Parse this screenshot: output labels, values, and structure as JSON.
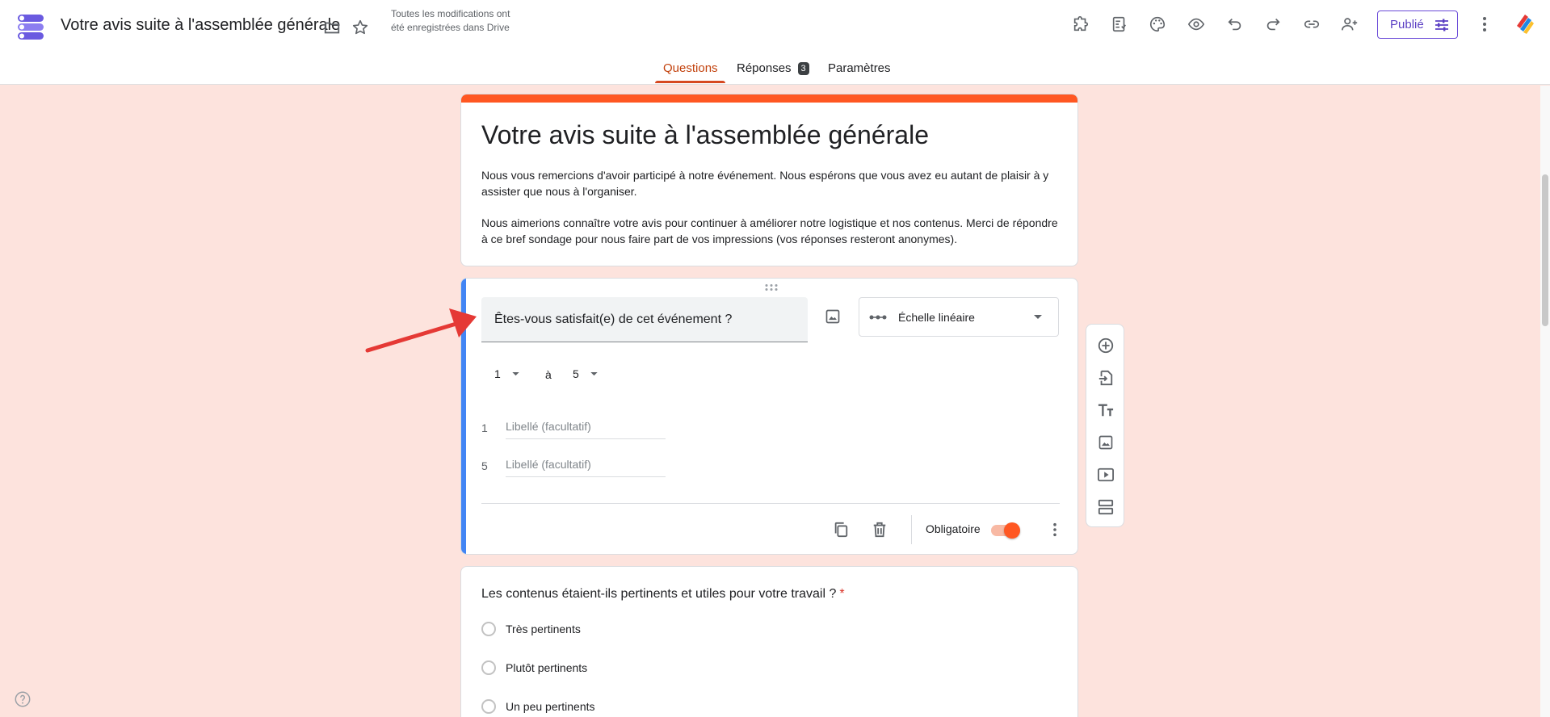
{
  "header": {
    "doc_title": "Votre avis suite à l'assemblée générale",
    "save_status": "Toutes les modifications ont été enregistrées dans Drive",
    "publish_label": "Publié",
    "icons": [
      "folder-icon",
      "star-icon",
      "addon-icon",
      "quiz-icon",
      "palette-icon",
      "preview-icon",
      "undo-icon",
      "redo-icon",
      "link-icon",
      "add-collaborator-icon",
      "more-vert-icon"
    ]
  },
  "tabs": [
    {
      "label": "Questions",
      "active": true
    },
    {
      "label": "Réponses",
      "badge": "3"
    },
    {
      "label": "Paramètres"
    }
  ],
  "form": {
    "title": "Votre avis suite à l'assemblée générale",
    "description": [
      "Nous vous remercions d'avoir participé à notre événement. Nous espérons que vous avez eu autant de plaisir à y assister que nous à l'organiser.",
      "Nous aimerions connaître votre avis pour continuer à améliorer notre logistique et nos contenus. Merci de répondre à ce bref sondage pour nous faire part de vos impressions (vos réponses resteront anonymes)."
    ],
    "accent_color": "#ff5722"
  },
  "question1": {
    "text": "Êtes-vous satisfait(e) de cet événement ?",
    "type_label": "Échelle linéaire",
    "scale_min": "1",
    "scale_word": "à",
    "scale_max": "5",
    "labels": [
      {
        "num": "1",
        "placeholder": "Libellé (facultatif)"
      },
      {
        "num": "5",
        "placeholder": "Libellé (facultatif)"
      }
    ],
    "required_label": "Obligatoire",
    "required_on": true
  },
  "question2": {
    "text": "Les contenus étaient-ils pertinents et utiles pour votre travail ?",
    "required_mark": "*",
    "options": [
      "Très pertinents",
      "Plutôt pertinents",
      "Un peu pertinents"
    ]
  },
  "side_toolbar": [
    "add-question-icon",
    "import-questions-icon",
    "add-title-icon",
    "add-image-icon",
    "add-video-icon",
    "add-section-icon"
  ],
  "colors": {
    "page_background": "#fde3dd",
    "active_tab": "#c2410c",
    "question_highlight": "#4285f4",
    "annotation_arrow": "#e53935"
  }
}
